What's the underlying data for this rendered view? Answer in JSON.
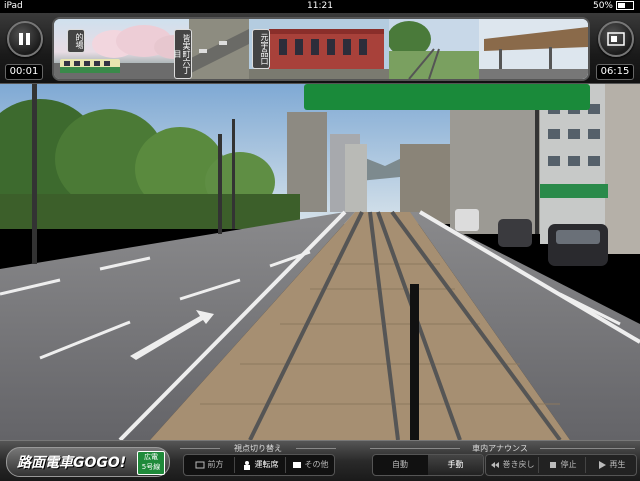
{
  "status_bar": {
    "carrier": "iPad",
    "time": "11:21",
    "battery": "50%"
  },
  "top_bar": {
    "pause_icon": "pause-icon",
    "elapsed": "00:01",
    "total": "06:15",
    "screen_icon": "screen-toggle-icon",
    "stops": [
      {
        "label": "的場"
      },
      {
        "label": "皆実町六丁目"
      },
      {
        "label": "元宇品口"
      }
    ]
  },
  "bottom_bar": {
    "logo": {
      "title": "路面電車GOGO!",
      "badge_line1": "広電",
      "badge_line2": "5号線"
    },
    "view_switch": {
      "label": "視点切り替え",
      "buttons": [
        {
          "label": "前方",
          "icon": "front-view-icon"
        },
        {
          "label": "運転席",
          "icon": "driver-seat-icon"
        },
        {
          "label": "その他",
          "icon": "other-view-icon"
        }
      ]
    },
    "announce": {
      "label": "車内アナウンス",
      "mode_buttons": [
        {
          "label": "自動"
        },
        {
          "label": "手動"
        }
      ],
      "controls": [
        {
          "label": "巻き戻し",
          "icon": "rewind-icon"
        },
        {
          "label": "停止",
          "icon": "stop-icon"
        },
        {
          "label": "再生",
          "icon": "play-icon"
        }
      ]
    }
  },
  "colors": {
    "sign_green": "#1a8a3a",
    "badge_green": "#1f8a3a",
    "bar_dark": "#1a1a1a"
  }
}
